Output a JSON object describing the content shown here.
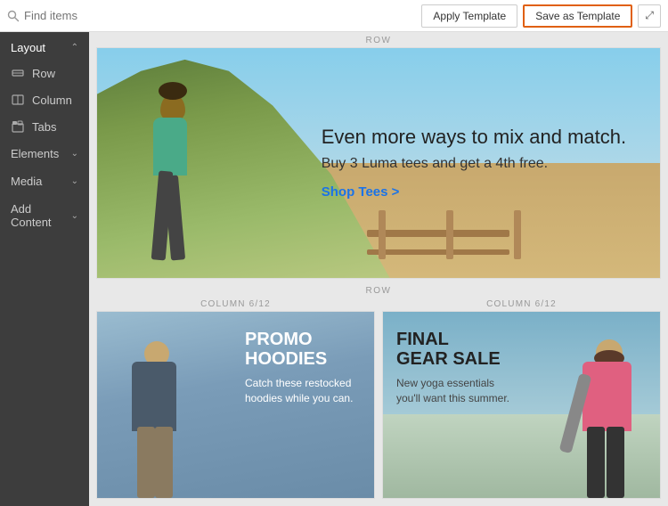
{
  "topbar": {
    "search_placeholder": "Find items",
    "apply_button": "Apply Template",
    "save_button": "Save as Template",
    "expand_icon": "⤢"
  },
  "sidebar": {
    "layout_label": "Layout",
    "items": [
      {
        "id": "row",
        "label": "Row",
        "icon": "row"
      },
      {
        "id": "column",
        "label": "Column",
        "icon": "column"
      },
      {
        "id": "tabs",
        "label": "Tabs",
        "icon": "tabs"
      }
    ],
    "sections": [
      {
        "id": "elements",
        "label": "Elements"
      },
      {
        "id": "media",
        "label": "Media"
      },
      {
        "id": "add-content",
        "label": "Add Content"
      }
    ]
  },
  "canvas": {
    "row_label": "ROW",
    "bottom_row_label": "ROW",
    "col1_label": "COLUMN 6/12",
    "col2_label": "COLUMN 6/12",
    "hero": {
      "headline": "Even more ways to mix and match.",
      "subtext": "Buy 3 Luma tees and get a 4th free.",
      "link_text": "Shop Tees >"
    },
    "panel1": {
      "title_line1": "PROMO",
      "title_line2": "HOODIES",
      "subtitle": "Catch these restocked hoodies while you can."
    },
    "panel2": {
      "title_line1": "FINAL",
      "title_line2": "GEAR SALE",
      "subtitle": "New yoga essentials you'll want this summer."
    }
  }
}
